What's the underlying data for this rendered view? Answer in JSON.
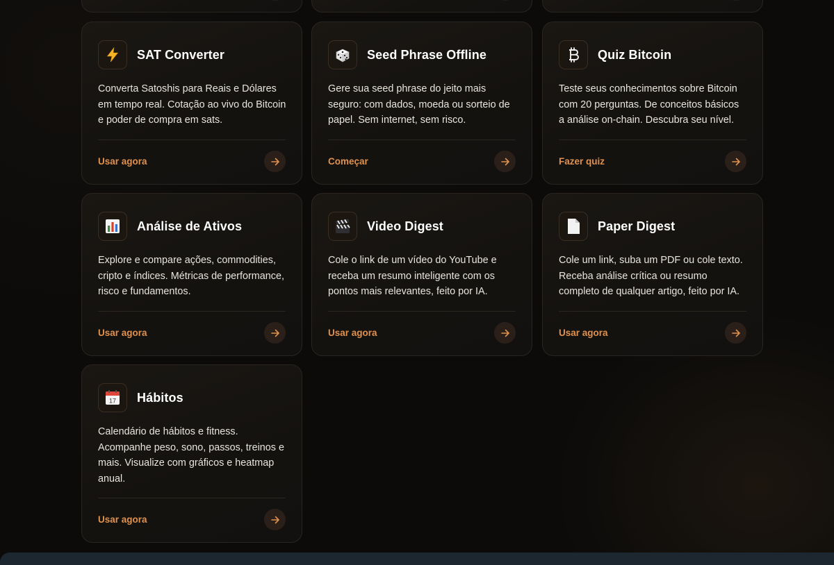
{
  "colors": {
    "accent": "#e0914d",
    "card_border": "#2a2520",
    "background": "#0c0b0a",
    "title": "#ffffff",
    "text": "#e8e4de"
  },
  "cards": [
    {
      "icon": "lightning-icon",
      "title": "SAT Converter",
      "desc_lines": [
        "Converta Satoshis para Reais e Dólares",
        "em tempo real. Cotação ao vivo do Bitcoin",
        "e poder de compra em sats."
      ],
      "cta": "Usar agora"
    },
    {
      "icon": "dice-icon",
      "title": "Seed Phrase Offline",
      "desc_lines": [
        "Gere sua seed phrase do jeito mais",
        "seguro: com dados, moeda ou sorteio de",
        "papel. Sem internet, sem risco."
      ],
      "cta": "Começar"
    },
    {
      "icon": "bitcoin-icon",
      "title": "Quiz Bitcoin",
      "desc_lines": [
        "Teste seus conhecimentos sobre Bitcoin",
        "com 20 perguntas. De conceitos básicos",
        "a análise on-chain. Descubra seu nível."
      ],
      "cta": "Fazer quiz"
    },
    {
      "icon": "bar-chart-icon",
      "title": "Análise de Ativos",
      "desc_lines": [
        "Explore e compare ações, commodities,",
        "cripto e índices. Métricas de performance,",
        "risco e fundamentos."
      ],
      "cta": "Usar agora"
    },
    {
      "icon": "clapperboard-icon",
      "title": "Video Digest",
      "desc_lines": [
        "Cole o link de um vídeo do YouTube e",
        "receba um resumo inteligente com os",
        "pontos mais relevantes, feito por IA."
      ],
      "cta": "Usar agora"
    },
    {
      "icon": "document-icon",
      "title": "Paper Digest",
      "desc_lines": [
        "Cole um link, suba um PDF ou cole texto.",
        "Receba análise crítica ou resumo",
        "completo de qualquer artigo, feito por IA."
      ],
      "cta": "Usar agora"
    },
    {
      "icon": "calendar-icon",
      "title": "Hábitos",
      "desc_lines": [
        "Calendário de hábitos e fitness.",
        "Acompanhe peso, sono, passos, treinos e",
        "mais. Visualize com gráficos e heatmap",
        "anual."
      ],
      "cta": "Usar agora",
      "calendar_day": "17"
    }
  ]
}
